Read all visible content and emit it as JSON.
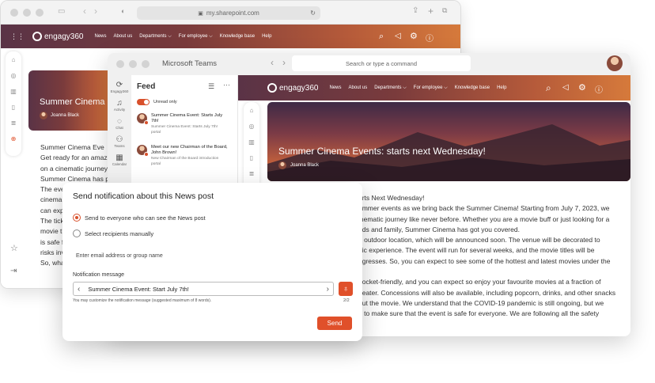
{
  "browser": {
    "url": "my.sharepoint.com",
    "brand": "engagy360",
    "nav": [
      "News",
      "About us",
      "Departments ⌵",
      "For employee ⌵",
      "Knowledge base",
      "Help"
    ],
    "hero_title": "Summer Cinema",
    "author": "Joanna Black",
    "article_lines": [
      "Summer Cinema Eve",
      "Get ready for an amaz",
      "on a cinematic journey",
      "Summer Cinema has p",
      "The eve",
      "cinema",
      "can exp",
      "The tick",
      "movie t",
      "is safe f",
      "risks inv",
      "So, wha"
    ]
  },
  "teams": {
    "title": "Microsoft Teams",
    "search_placeholder": "Search or type a command",
    "rail": [
      {
        "icon": "engagy",
        "label": "Engagy360"
      },
      {
        "icon": "bell",
        "label": "Activity"
      },
      {
        "icon": "chat",
        "label": "Chat"
      },
      {
        "icon": "teams",
        "label": "Teams"
      },
      {
        "icon": "calendar",
        "label": "Calendar"
      }
    ],
    "feed": {
      "title": "Feed",
      "toggle_label": "Unread only",
      "items": [
        {
          "title": "Summer Cinema Event: Starts July 7th!",
          "sub": "Summer Cinema Event: Starts July 7th!",
          "source": "portal"
        },
        {
          "title": "Meet our new Chairman of the Board, John Brown!",
          "sub": "New Chairman of the Board introduction",
          "source": "portal"
        }
      ]
    },
    "portal": {
      "brand": "engagy360",
      "nav": [
        "News",
        "About us",
        "Departments ⌵",
        "For employee ⌵",
        "Knowledge base",
        "Help"
      ],
      "hero_title": "Summer Cinema Events: starts next Wednesday!",
      "author": "Joanna Black",
      "article_lines": [
        "arts Next Wednesday!",
        "ummer events as we bring back the Summer Cinema! Starting from July 7, 2023, we",
        "inematic journey like never before. Whether you are a movie buff or just looking for a",
        "ads and family, Summer Cinema has got you covered.",
        "n outdoor location, which will be announced soon. The venue will be decorated to",
        "gic experience. The event will run for several weeks, and the movie titles will be",
        "ogresses. So, you can expect to see some of the hottest and latest movies under the",
        "",
        "pocket-friendly, and you can expect so enjoy your favourite movies at a fraction of",
        "heater. Concessions will also be available, including popcorn, drinks, and other snacks",
        "out the movie. We understand that the COVID-19 pandemic is still ongoing, but we",
        "n to make sure that the event is safe for everyone. We are following all the safety"
      ]
    }
  },
  "dialog": {
    "title": "Send notification about this News post",
    "option_all": "Send to everyone who can see the News post",
    "option_manual": "Select recipients manually",
    "email_placeholder": "Enter email address or group name",
    "message_label": "Notification message",
    "message_value": "Summer Cinema Event: Start July 7th!",
    "hint": "You may customize the notification message (suggested maximum of 8 words).",
    "counter": "2/2",
    "send_label": "Send"
  },
  "colors": {
    "accent": "#E0502A"
  }
}
